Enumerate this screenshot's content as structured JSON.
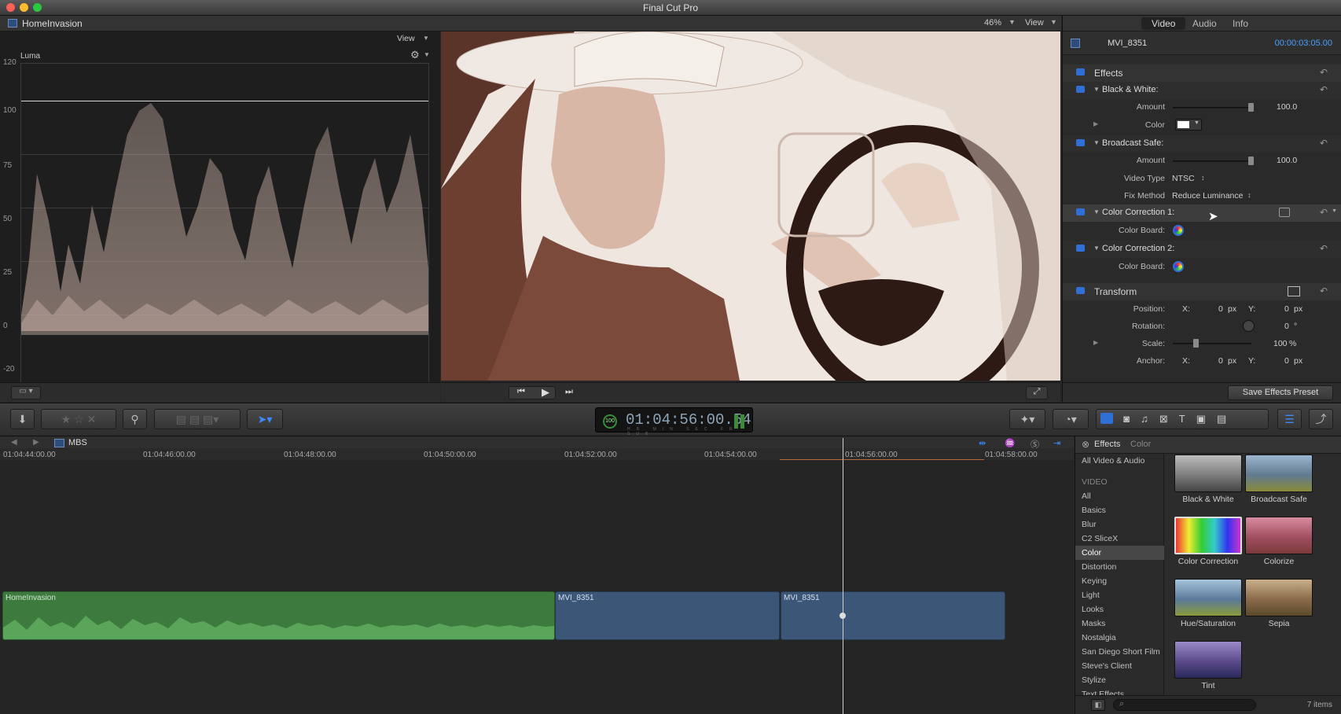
{
  "app": {
    "title": "Final Cut Pro"
  },
  "viewer_header": {
    "project": "HomeInvasion",
    "view_label": "View",
    "zoom": "46%",
    "view_label2": "View"
  },
  "scope": {
    "name": "Luma",
    "view_label": "View",
    "y_ticks": [
      "120",
      "100",
      "75",
      "50",
      "25",
      "0",
      "-20"
    ]
  },
  "inspector": {
    "tabs": [
      "Video",
      "Audio",
      "Info"
    ],
    "clip_name": "MVI_8351",
    "clip_duration": "00:00:03:05.00",
    "effects_header": "Effects",
    "bw": {
      "title": "Black & White:",
      "amount_label": "Amount",
      "amount": "100.0",
      "color_label": "Color"
    },
    "bsafe": {
      "title": "Broadcast Safe:",
      "amount_label": "Amount",
      "amount": "100.0",
      "video_type_label": "Video Type",
      "video_type": "NTSC",
      "fix_method_label": "Fix Method",
      "fix_method": "Reduce Luminance"
    },
    "cc1": {
      "title": "Color Correction 1:",
      "board_label": "Color Board:"
    },
    "cc2": {
      "title": "Color Correction 2:",
      "board_label": "Color Board:"
    },
    "transform": {
      "title": "Transform",
      "position_label": "Position:",
      "x_label": "X:",
      "pos_x": "0",
      "y_label": "Y:",
      "pos_y": "0",
      "unit_px": "px",
      "rotation_label": "Rotation:",
      "rotation": "0",
      "deg": "°",
      "scale_label": "Scale:",
      "scale": "100",
      "pct": "%",
      "anchor_label": "Anchor:",
      "anc_x": "0",
      "anc_y": "0"
    },
    "save_preset": "Save Effects Preset"
  },
  "toolbar": {
    "timecode": "01:04:56:00.54",
    "tc_units": [
      "HR",
      "MIN",
      "SEC",
      "FR",
      "SUB"
    ],
    "pct": "100"
  },
  "timeline": {
    "project": "MBS",
    "ruler": [
      "01:04:44:00.00",
      "01:04:46:00.00",
      "01:04:48:00.00",
      "01:04:50:00.00",
      "01:04:52:00.00",
      "01:04:54:00.00",
      "01:04:56:00.00",
      "01:04:58:00.00"
    ],
    "clips": [
      {
        "name": "HomeInvasion"
      },
      {
        "name": "MVI_8351"
      },
      {
        "name": "MVI_8351"
      }
    ]
  },
  "browser": {
    "title": "Effects",
    "subtitle": "Color",
    "categories": [
      "All Video & Audio",
      "VIDEO",
      "All",
      "Basics",
      "Blur",
      "C2 SliceX",
      "Color",
      "Distortion",
      "Keying",
      "Light",
      "Looks",
      "Masks",
      "Nostalgia",
      "San Diego Short Film",
      "Steve's Client",
      "Stylize",
      "Text Effects"
    ],
    "selected_category": "Color",
    "effects": [
      "Black & White",
      "Broadcast Safe",
      "Color Correction",
      "Colorize",
      "Hue/Saturation",
      "Sepia",
      "Tint"
    ],
    "count": "7 items"
  },
  "colors": {
    "accent_blue": "#2f6fd6",
    "clip_green": "#3d7a3d",
    "clip_blue": "#3b5677",
    "timecode_blue": "#4aa0ff"
  }
}
